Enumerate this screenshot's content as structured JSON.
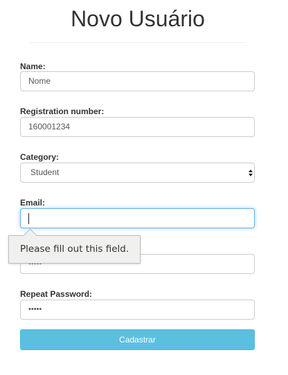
{
  "page": {
    "title": "Novo Usuário"
  },
  "form": {
    "name": {
      "label": "Name:",
      "value": "Nome"
    },
    "registration": {
      "label": "Registration number:",
      "value": "160001234"
    },
    "category": {
      "label": "Category:",
      "selected": "Student"
    },
    "email": {
      "label": "Email:",
      "value": ""
    },
    "password": {
      "value": "•••••"
    },
    "repeat_password": {
      "label": "Repeat Password:",
      "value": "•••••"
    },
    "submit_label": "Cadastrar"
  },
  "validation": {
    "message": "Please fill out this field."
  },
  "colors": {
    "button_bg": "#5bc0de",
    "focus_border": "#66afe9",
    "tooltip_bg": "#f0f0ee"
  }
}
